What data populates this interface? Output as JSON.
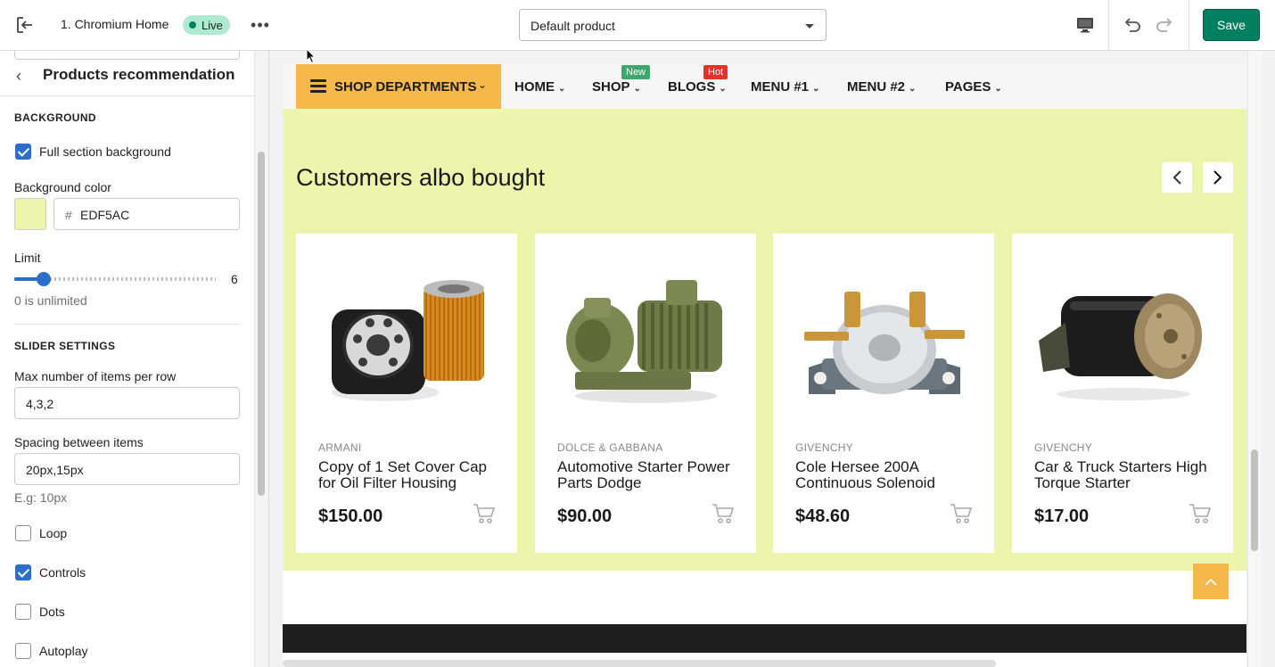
{
  "topbar": {
    "theme_name": "1. Chromium Home",
    "status": "Live",
    "more": "•••",
    "product_select": "Default product",
    "save_label": "Save"
  },
  "sidebar": {
    "back_title": "Products recommendation",
    "background_heading": "BACKGROUND",
    "full_bg_label": "Full section background",
    "full_bg_checked": true,
    "bg_color_label": "Background color",
    "bg_color_hash": "#",
    "bg_color_value": "EDF5AC",
    "bg_color": "#EDF5AC",
    "limit_label": "Limit",
    "limit_value": "6",
    "limit_help": "0 is unlimited",
    "slider_heading": "SLIDER SETTINGS",
    "max_items_label": "Max number of items per row",
    "max_items_value": "4,3,2",
    "spacing_label": "Spacing between items",
    "spacing_value": "20px,15px",
    "spacing_help": "E.g: 10px",
    "options": [
      {
        "label": "Loop",
        "checked": false
      },
      {
        "label": "Controls",
        "checked": true
      },
      {
        "label": "Dots",
        "checked": false
      },
      {
        "label": "Autoplay",
        "checked": false
      }
    ]
  },
  "preview": {
    "nav": {
      "departments": "SHOP DEPARTMENTS",
      "items": [
        {
          "label": "HOME"
        },
        {
          "label": "SHOP",
          "tag": "New",
          "tag_color": "#3ea86b"
        },
        {
          "label": "BLOGS",
          "tag": "Hot",
          "tag_color": "#e2332b"
        },
        {
          "label": "MENU #1"
        },
        {
          "label": "MENU #2"
        },
        {
          "label": "PAGES"
        }
      ]
    },
    "section_title": "Customers albo bought",
    "section_bg": "#EDF5AC",
    "accent": "#F7B84B",
    "products": [
      {
        "brand": "ARMANI",
        "name": "Copy of 1 Set Cover Cap for Oil Filter Housing",
        "price": "$150.00",
        "image": "oil-filter-image"
      },
      {
        "brand": "DOLCE & GABBANA",
        "name": "Automotive Starter Power Parts Dodge",
        "price": "$90.00",
        "image": "water-pump-image"
      },
      {
        "brand": "GIVENCHY",
        "name": "Cole Hersee 200A Continuous Solenoid",
        "price": "$48.60",
        "image": "solenoid-image"
      },
      {
        "brand": "GIVENCHY",
        "name": "Car & Truck Starters High Torque Starter",
        "price": "$17.00",
        "image": "starter-motor-image"
      }
    ]
  }
}
